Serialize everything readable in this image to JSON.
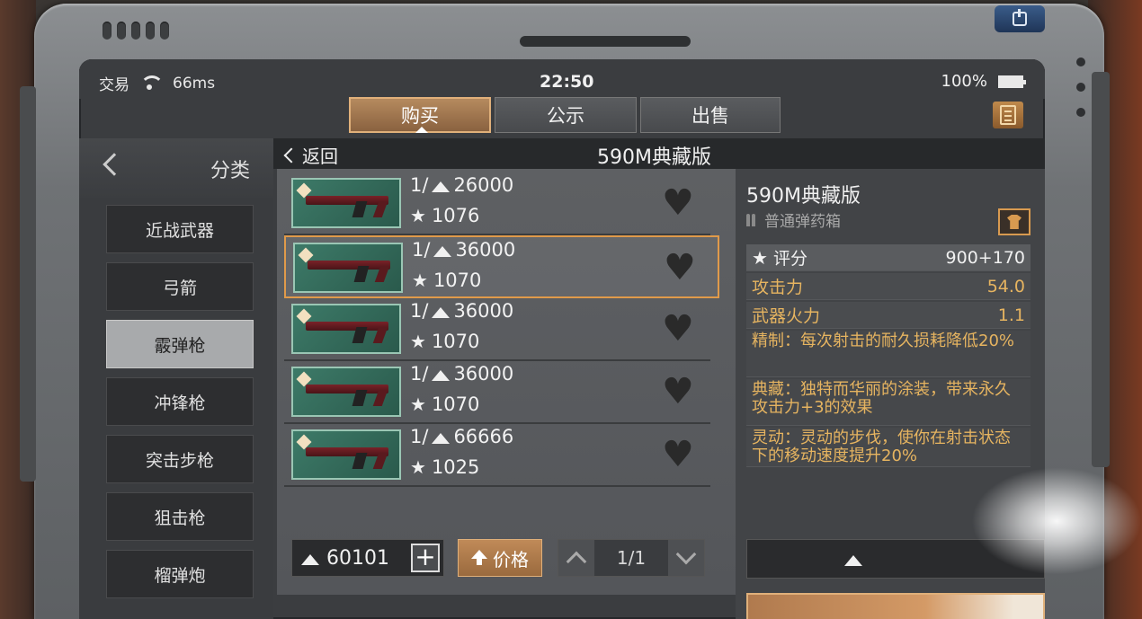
{
  "status": {
    "app_label": "交易",
    "ping": "66ms",
    "time": "22:50",
    "battery": "100%"
  },
  "tabs": [
    {
      "label": "购买",
      "active": true
    },
    {
      "label": "公示",
      "active": false
    },
    {
      "label": "出售",
      "active": false
    }
  ],
  "category": {
    "title": "分类",
    "items": [
      {
        "label": "近战武器",
        "active": false
      },
      {
        "label": "弓箭",
        "active": false
      },
      {
        "label": "霰弹枪",
        "active": true
      },
      {
        "label": "冲锋枪",
        "active": false
      },
      {
        "label": "突击步枪",
        "active": false
      },
      {
        "label": "狙击枪",
        "active": false
      },
      {
        "label": "榴弹炮",
        "active": false
      }
    ]
  },
  "listing": {
    "back_label": "返回",
    "title": "590M典藏版",
    "rows": [
      {
        "qty": "1/",
        "price": "26000",
        "score": "1076",
        "selected": false
      },
      {
        "qty": "1/",
        "price": "36000",
        "score": "1070",
        "selected": true
      },
      {
        "qty": "1/",
        "price": "36000",
        "score": "1070",
        "selected": false
      },
      {
        "qty": "1/",
        "price": "36000",
        "score": "1070",
        "selected": false
      },
      {
        "qty": "1/",
        "price": "66666",
        "score": "1025",
        "selected": false
      }
    ],
    "wallet": "60101",
    "sort_label": "价格",
    "page": "1/1"
  },
  "detail": {
    "name": "590M典藏版",
    "box": "普通弹药箱",
    "score_label": "评分",
    "score_value": "900+170",
    "stats": [
      {
        "label": "攻击力",
        "value": "54.0"
      },
      {
        "label": "武器火力",
        "value": "1.1"
      }
    ],
    "descriptions": [
      "精制：每次射击的耐久损耗降低20%",
      "典藏：独特而华丽的涂装，带来永久攻击力+3的效果",
      "灵动：灵动的步伐，使你在射击状态下的移动速度提升20%"
    ]
  },
  "colors": {
    "accent": "#e09a4a",
    "gold_text": "#e6b460"
  }
}
